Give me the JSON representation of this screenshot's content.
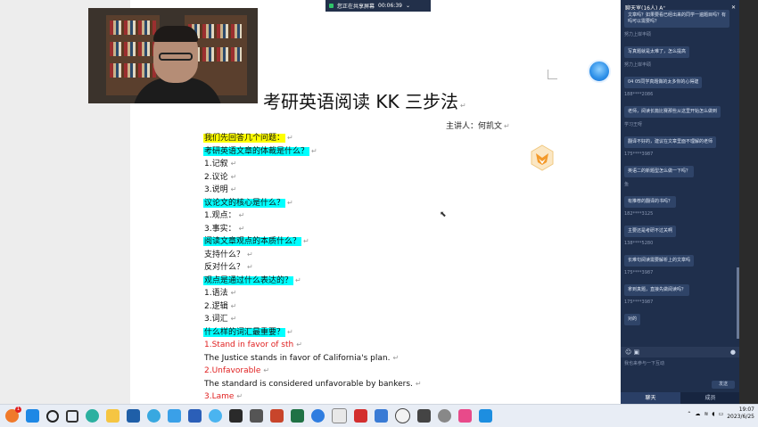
{
  "share_bar": {
    "status": "您正在共享屏幕",
    "timer": "00:06:39"
  },
  "document": {
    "title": "考研英语阅读 KK 三步法",
    "lecturer": "主讲人：何凯文",
    "lines": [
      {
        "text": "我们先回答几个问题：",
        "style": "hl-yellow",
        "mark": "↵"
      },
      {
        "text": "考研英语文章的体裁是什么？",
        "style": "hl-cyan",
        "mark": "↵"
      },
      {
        "text": "1.记叙",
        "style": "plain",
        "mark": "↵"
      },
      {
        "text": "2.议论",
        "style": "plain",
        "mark": "↵"
      },
      {
        "text": "3.说明",
        "style": "plain",
        "mark": "↵"
      },
      {
        "text": "议论文的核心是什么？",
        "style": "hl-cyan",
        "mark": "↵"
      },
      {
        "text": "1.观点：",
        "style": "plain",
        "mark": "↵"
      },
      {
        "text": "3.事实：",
        "style": "plain",
        "mark": "↵"
      },
      {
        "text": "阅读文章观点的本质什么？",
        "style": "hl-cyan",
        "mark": "↵"
      },
      {
        "text": "支持什么？",
        "style": "plain",
        "mark": "↵"
      },
      {
        "text": "反对什么？",
        "style": "plain",
        "mark": "↵"
      },
      {
        "text": "观点是通过什么表达的？",
        "style": "hl-cyan",
        "mark": "↵"
      },
      {
        "text": "1.语法",
        "style": "plain",
        "mark": "↵"
      },
      {
        "text": "2.逻辑",
        "style": "plain",
        "mark": "↵"
      },
      {
        "text": "3.词汇",
        "style": "plain",
        "mark": "↵"
      },
      {
        "text": "什么样的词汇最重要？",
        "style": "hl-cyan",
        "mark": "↵"
      },
      {
        "text": "1.Stand in favor of sth",
        "style": "red",
        "mark": "↵"
      },
      {
        "text": "The Justice stands in favor of California's plan.",
        "style": "plain",
        "mark": "↵"
      },
      {
        "text": "2.Unfavorable",
        "style": "red",
        "mark": "↵"
      },
      {
        "text": "The standard is considered unfavorable by bankers.",
        "style": "plain",
        "mark": "↵"
      },
      {
        "text": "3.Lame",
        "style": "red",
        "mark": "↵"
      }
    ]
  },
  "chat": {
    "header": "聊天室(16人)",
    "font_toggle": "A⁺",
    "messages": [
      {
        "user": "",
        "text": "文章吗？如果要看已经出来的同学一遍题目吗？有吗可以需要吗？"
      },
      {
        "user": "努力上岸丰硕",
        "text": "写真题就是太难了，怎么提高"
      },
      {
        "user": "努力上岸丰硕",
        "text": "04 05同学真题做的太多你的心得建"
      },
      {
        "user": "188****2086",
        "text": "老师，阅读长篇比赛那些从这里开始怎么做到"
      },
      {
        "user": "学习王呀",
        "text": "翻译不好的，建议在文章里面不理解的老师"
      },
      {
        "user": "175****3987",
        "text": "英语二的新题型怎么做一下吗？"
      },
      {
        "user": "鱼",
        "text": "有推荐的翻译的书吗？"
      },
      {
        "user": "182****3125",
        "text": "主要还是考研不过关啊"
      },
      {
        "user": "138****5280",
        "text": "长难句阅读需要解析上的文章吗"
      },
      {
        "user": "175****3987",
        "text": "拿到真题，直接先做阅读吗？"
      },
      {
        "user": "175****3987",
        "text": "对的"
      }
    ],
    "input_placeholder": "我也来参与一下互动",
    "send_label": "发送",
    "tabs": [
      "聊天",
      "成员"
    ]
  },
  "taskbar": {
    "notification_count": "1",
    "time": "19:07",
    "date": "2023/6/25"
  }
}
